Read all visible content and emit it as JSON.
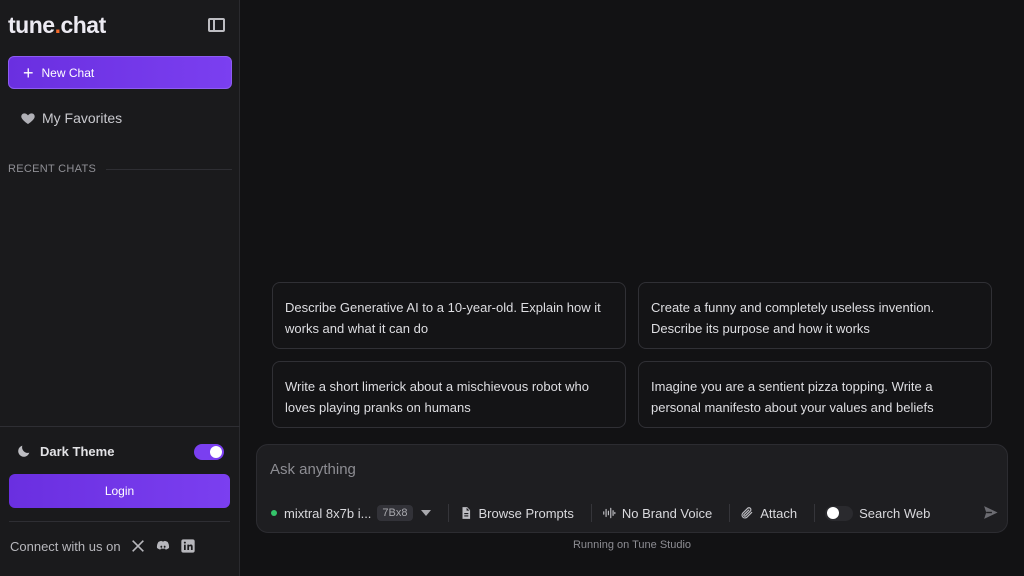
{
  "sidebar": {
    "logo_main": "tune",
    "logo_dot": ".",
    "logo_tail": "chat",
    "new_chat": "New Chat",
    "favorites": "My Favorites",
    "recent_chats": "RECENT CHATS",
    "dark_theme": "Dark Theme",
    "dark_theme_on": true,
    "login": "Login",
    "connect": "Connect with us on",
    "social_icons": [
      "x-icon",
      "discord-icon",
      "linkedin-icon"
    ]
  },
  "suggestions": [
    "Describe Generative AI to a 10-year-old. Explain how it works and what it can do",
    "Create a funny and completely useless invention. Describe its purpose and how it works",
    "Write a short limerick about a mischievous robot who loves playing pranks on humans",
    "Imagine you are a sentient pizza topping. Write a personal manifesto about your values and beliefs"
  ],
  "composer": {
    "placeholder": "Ask anything",
    "model": "mixtral 8x7b i...",
    "model_badge": "7Bx8",
    "browse_prompts": "Browse Prompts",
    "brand_voice": "No Brand Voice",
    "attach": "Attach",
    "search_web": "Search Web",
    "search_web_on": false
  },
  "footer": "Running on Tune Studio",
  "colors": {
    "accent": "#7b3ff0",
    "logo_dot": "#f36a2a",
    "background": "#121214",
    "sidebar": "#1a1a1c"
  }
}
